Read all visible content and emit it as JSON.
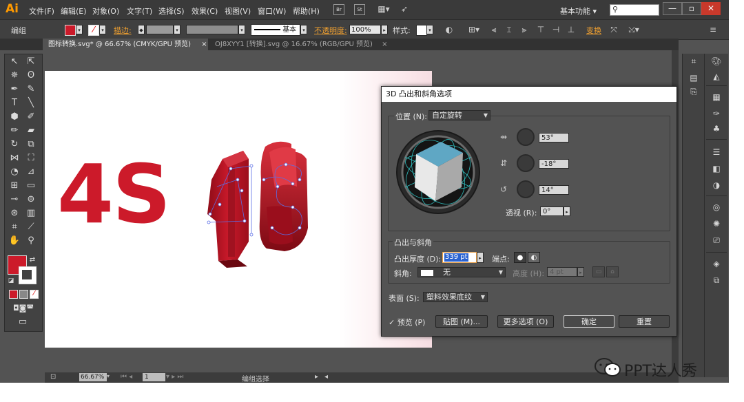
{
  "app": {
    "logo": "Ai",
    "menus": [
      "文件(F)",
      "编辑(E)",
      "对象(O)",
      "文字(T)",
      "选择(S)",
      "效果(C)",
      "视图(V)",
      "窗口(W)",
      "帮助(H)"
    ],
    "bridge_label": "Br",
    "stock_label": "St",
    "workspace": "基本功能",
    "colors": {
      "accent": "#ff9a00",
      "brand_red": "#cc1a2a"
    }
  },
  "control": {
    "selection_label": "编组",
    "stroke_label": "描边:",
    "stroke_style": "基本",
    "opacity_label": "不透明度:",
    "opacity_value": "100%",
    "style_label": "样式:",
    "transform_label": "变换"
  },
  "tabs": [
    {
      "label": "图标转换.svg* @ 66.67% (CMYK/GPU 预览)",
      "close": "×"
    },
    {
      "label": "OJ8XYY1 [转换].svg @ 16.67% (RGB/GPU 预览)",
      "close": "×"
    }
  ],
  "canvas": {
    "text": "4S"
  },
  "status": {
    "zoom": "66.67%",
    "page": "1",
    "mode": "编组选择"
  },
  "dialog": {
    "title": "3D 凸出和斜角选项",
    "position_label": "位置 (N):",
    "position_value": "自定旋转",
    "rot_x": "53°",
    "rot_y": "-18°",
    "rot_z": "14°",
    "perspective_label": "透视 (R):",
    "perspective_value": "0°",
    "extrude_group": "凸出与斜角",
    "depth_label": "凸出厚度 (D):",
    "depth_value": "339 pt",
    "cap_label": "端点:",
    "bevel_label": "斜角:",
    "bevel_value": "无",
    "height_label": "高度 (H):",
    "height_value": "4 pt",
    "surface_label": "表面 (S):",
    "surface_value": "塑料效果底纹",
    "preview_label": "预览 (P)",
    "map_button": "贴图 (M)...",
    "more_button": "更多选项 (O)",
    "ok_button": "确定",
    "reset_button": "重置"
  },
  "watermark": "PPT达人秀"
}
